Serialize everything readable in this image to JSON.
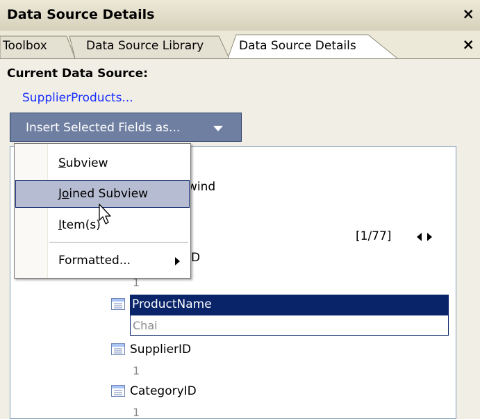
{
  "window": {
    "title": "Data Source Details",
    "close_glyph": "×"
  },
  "tabs": [
    {
      "label": "Toolbox",
      "active": false
    },
    {
      "label": "Data Source Library",
      "active": false
    },
    {
      "label": "Data Source Details",
      "active": true
    }
  ],
  "tab_close_glyph": "×",
  "current_source": {
    "heading": "Current Data Source:",
    "link": "SupplierProducts..."
  },
  "insert_button": {
    "label": "Insert Selected Fields as...",
    "icon": "dropdown-arrow-icon"
  },
  "menu": {
    "items": [
      {
        "label": "Subview",
        "mnemonic": "S"
      },
      {
        "label": "Joined Subview",
        "mnemonic": "o",
        "highlighted": true
      },
      {
        "label": "Item(s)",
        "mnemonic": "I"
      },
      {
        "label": "Formatted...",
        "has_submenu": true
      }
    ]
  },
  "tree": {
    "partial_text_1": "wind",
    "pager": "[1/77]",
    "partial_text_2": "D",
    "partial_value": "1",
    "fields": [
      {
        "name": "ProductName",
        "value": "Chai",
        "selected": true
      },
      {
        "name": "SupplierID",
        "value": "1"
      },
      {
        "name": "CategoryID",
        "value": "1"
      }
    ]
  },
  "colors": {
    "selection": "#0a246a",
    "link": "#1a2fff",
    "button": "#6f7fa2",
    "menu_highlight": "#b6bdd2"
  }
}
